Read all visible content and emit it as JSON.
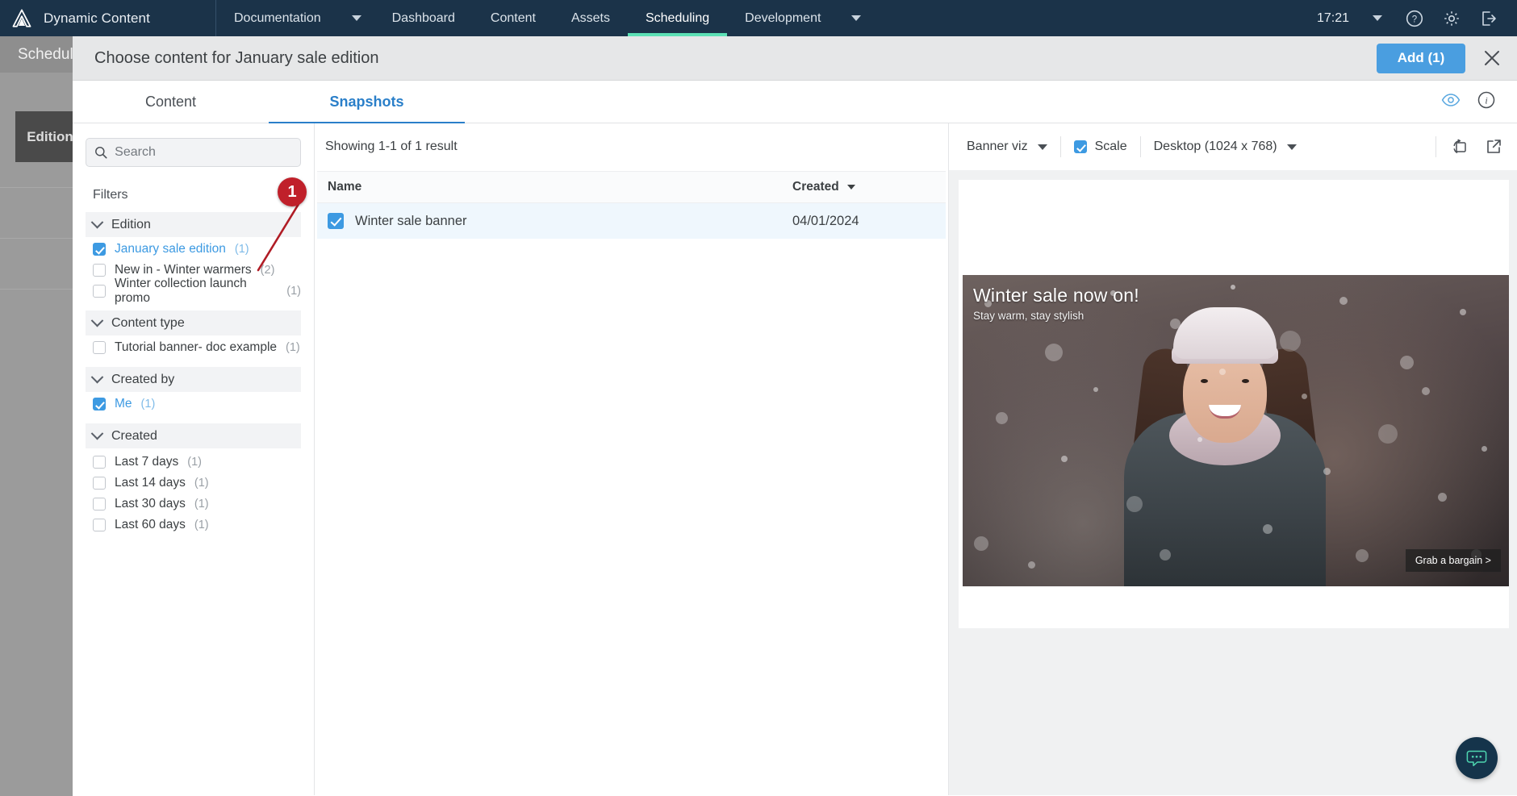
{
  "topnav": {
    "brand": "Dynamic Content",
    "items": [
      {
        "label": "Documentation",
        "active": false,
        "caret": true
      },
      {
        "label": "Dashboard",
        "active": false,
        "caret": false
      },
      {
        "label": "Content",
        "active": false,
        "caret": false
      },
      {
        "label": "Assets",
        "active": false,
        "caret": false
      },
      {
        "label": "Scheduling",
        "active": true,
        "caret": false
      },
      {
        "label": "Development",
        "active": false,
        "caret": true
      }
    ],
    "time": "17:21",
    "icons": [
      "chevron-down-icon",
      "help-icon",
      "gear-icon",
      "logout-icon"
    ]
  },
  "background_page": {
    "header_title": "Scheduling",
    "card_label": "Edition"
  },
  "modal": {
    "title": "Choose content for January sale edition",
    "add_button": "Add (1)",
    "close_icon": "close-icon",
    "tabs": [
      {
        "label": "Content",
        "active": false
      },
      {
        "label": "Snapshots",
        "active": true
      }
    ],
    "tab_actions": [
      "eye-icon",
      "info-icon"
    ]
  },
  "filters": {
    "search_placeholder": "Search",
    "search_value": "",
    "heading": "Filters",
    "groups": [
      {
        "title": "Edition",
        "expanded": true,
        "items": [
          {
            "label": "January sale edition",
            "count": "(1)",
            "checked": true
          },
          {
            "label": "New in - Winter warmers",
            "count": "(2)",
            "checked": false
          },
          {
            "label": "Winter collection launch promo",
            "count": "(1)",
            "checked": false
          }
        ]
      },
      {
        "title": "Content type",
        "expanded": true,
        "items": [
          {
            "label": "Tutorial banner- doc example",
            "count": "(1)",
            "checked": false
          }
        ]
      },
      {
        "title": "Created by",
        "expanded": true,
        "items": [
          {
            "label": "Me",
            "count": "(1)",
            "checked": true
          }
        ]
      },
      {
        "title": "Created",
        "expanded": true,
        "items": [
          {
            "label": "Last 7 days",
            "count": "(1)",
            "checked": false
          },
          {
            "label": "Last 14 days",
            "count": "(1)",
            "checked": false
          },
          {
            "label": "Last 30 days",
            "count": "(1)",
            "checked": false
          },
          {
            "label": "Last 60 days",
            "count": "(1)",
            "checked": false
          }
        ]
      }
    ]
  },
  "annotation": {
    "marker_label": "1",
    "color": "#c0202a"
  },
  "results": {
    "showing": "Showing 1-1 of 1 result",
    "columns": {
      "name": "Name",
      "created": "Created"
    },
    "rows": [
      {
        "name": "Winter sale banner",
        "created": "04/01/2024",
        "checked": true
      }
    ]
  },
  "preview": {
    "viz_select": "Banner viz",
    "scale_label": "Scale",
    "scale_checked": true,
    "device_select": "Desktop (1024 x 768)",
    "icons": [
      "refresh-device-icon",
      "open-external-icon"
    ],
    "banner": {
      "title": "Winter sale now on!",
      "subtitle": "Stay warm, stay stylish",
      "cta": "Grab a bargain >"
    }
  },
  "chat": {
    "icon": "chat-bubble-icon"
  },
  "colors": {
    "nav_bg": "#1b3349",
    "accent_teal": "#5ce0b5",
    "accent_blue": "#3d9ae2",
    "tab_blue": "#2a7fc9",
    "marker_red": "#c0202a"
  }
}
